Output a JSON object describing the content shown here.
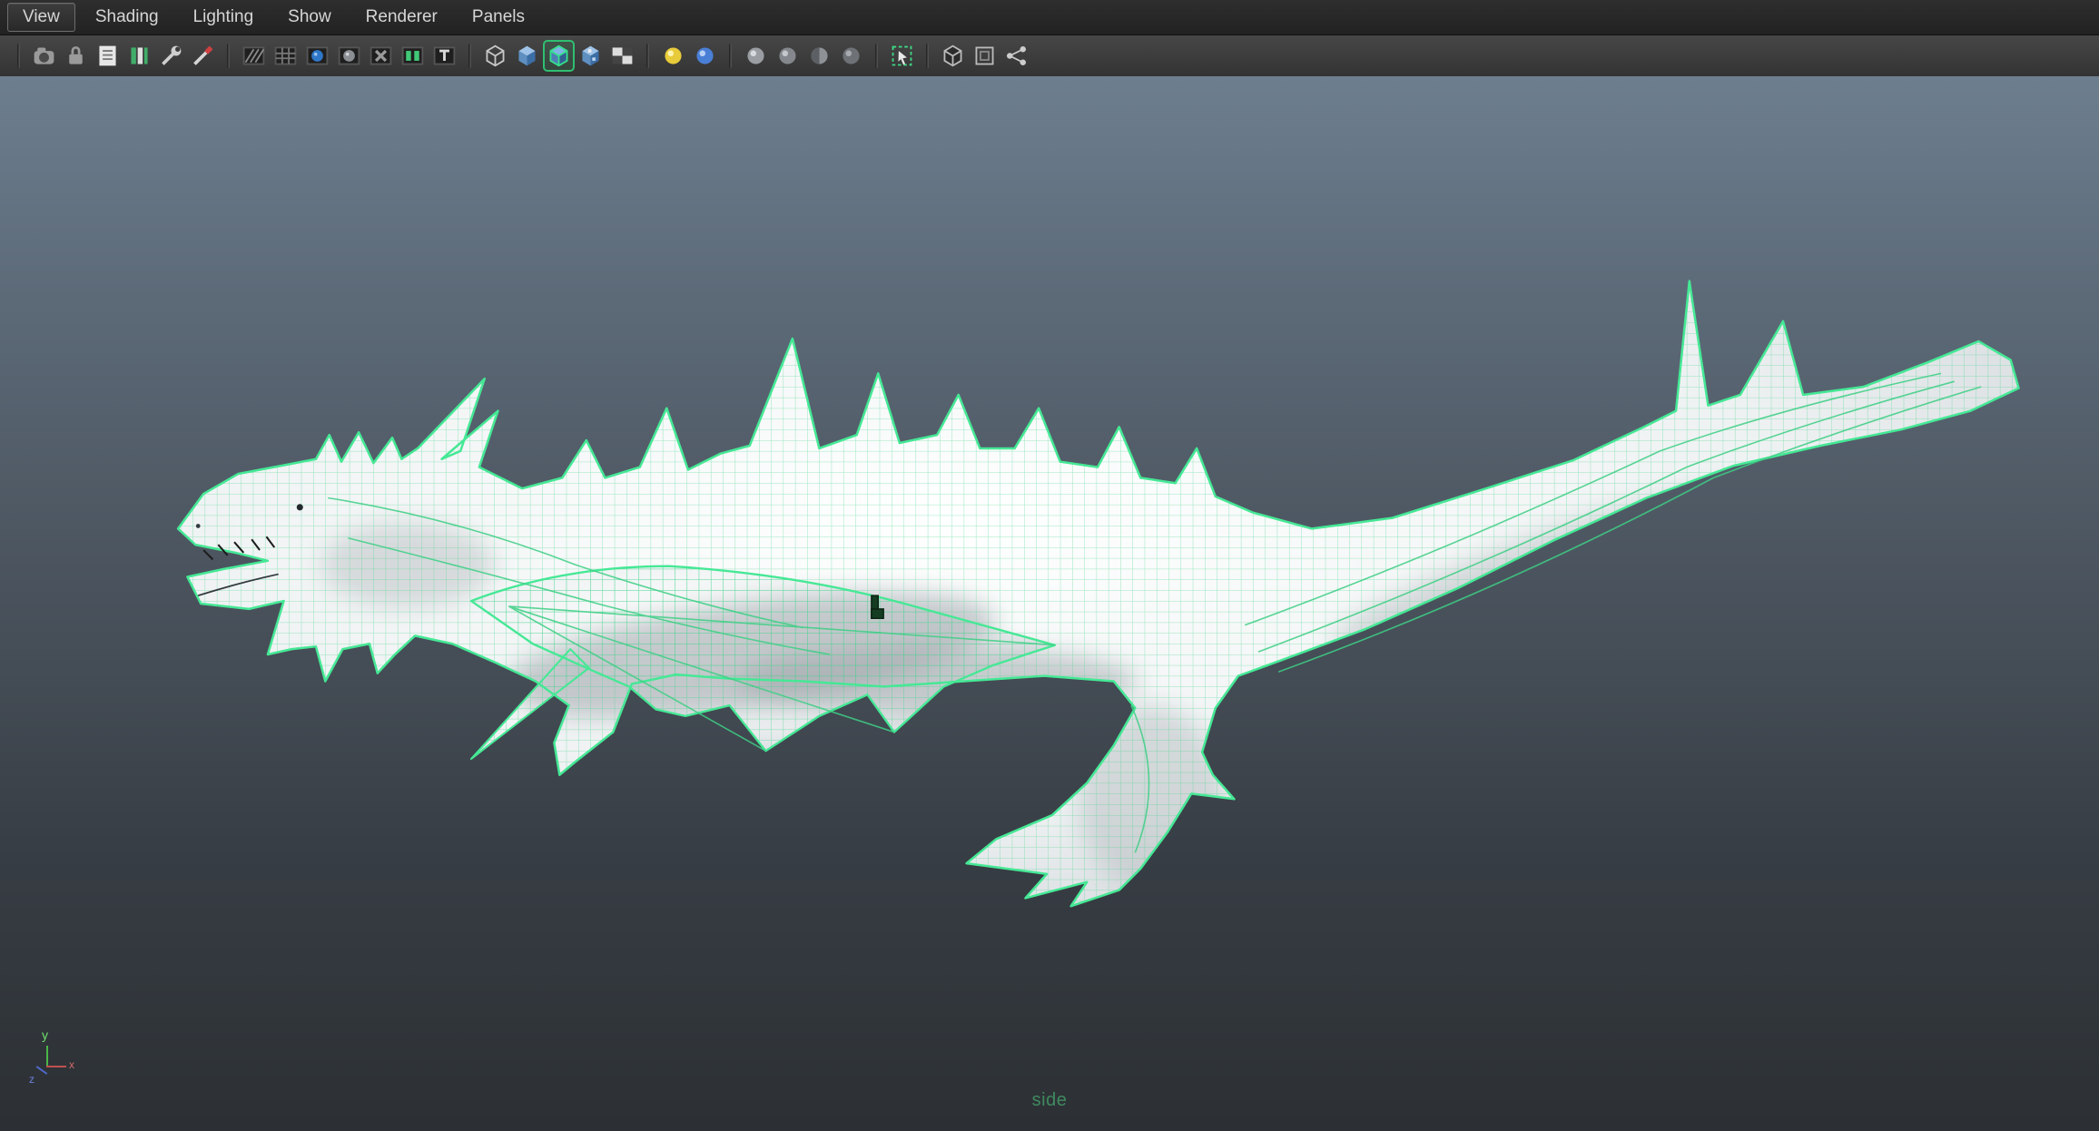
{
  "menubar": {
    "items": [
      {
        "label": "View",
        "boxed": true
      },
      {
        "label": "Shading",
        "boxed": false
      },
      {
        "label": "Lighting",
        "boxed": false
      },
      {
        "label": "Show",
        "boxed": false
      },
      {
        "label": "Renderer",
        "boxed": false
      },
      {
        "label": "Panels",
        "boxed": false
      }
    ]
  },
  "toolbar": {
    "items": [
      {
        "type": "separator"
      },
      {
        "type": "icon",
        "name": "select-camera-icon",
        "glyph": "camera",
        "active": false
      },
      {
        "type": "icon",
        "name": "lock-camera-icon",
        "glyph": "lock",
        "active": false
      },
      {
        "type": "icon",
        "name": "camera-attribute-editor-icon",
        "glyph": "doc",
        "active": false
      },
      {
        "type": "icon",
        "name": "bookmarks-icon",
        "glyph": "greenbars",
        "active": false
      },
      {
        "type": "icon",
        "name": "2d-pan-zoom-icon",
        "glyph": "wrench",
        "active": false
      },
      {
        "type": "icon",
        "name": "grease-pencil-icon",
        "glyph": "brush",
        "active": false
      },
      {
        "type": "separator"
      },
      {
        "type": "icon",
        "name": "film-gate-icon",
        "glyph": "filmstripes",
        "active": false
      },
      {
        "type": "icon",
        "name": "resolution-gate-icon",
        "glyph": "gridgate",
        "active": false
      },
      {
        "type": "icon",
        "name": "gate-mask-icon",
        "glyph": "bluecircle",
        "active": false
      },
      {
        "type": "icon",
        "name": "field-chart-icon",
        "glyph": "graycircle",
        "active": false
      },
      {
        "type": "icon",
        "name": "safe-action-icon",
        "glyph": "xicon",
        "active": false
      },
      {
        "type": "icon",
        "name": "heads-up-display-icon",
        "glyph": "greensquares",
        "active": false
      },
      {
        "type": "icon",
        "name": "safe-title-icon",
        "glyph": "tletter",
        "active": false
      },
      {
        "type": "separator"
      },
      {
        "type": "icon",
        "name": "wireframe-icon",
        "glyph": "cube-wire",
        "active": false
      },
      {
        "type": "icon",
        "name": "smooth-shade-all-icon",
        "glyph": "cube-shaded",
        "active": false
      },
      {
        "type": "icon",
        "name": "wireframe-on-shaded-icon",
        "glyph": "cube-wos",
        "active": true
      },
      {
        "type": "icon",
        "name": "textured-icon",
        "glyph": "cube-tex",
        "active": false
      },
      {
        "type": "icon",
        "name": "use-default-material-icon",
        "glyph": "checker",
        "active": false
      },
      {
        "type": "separator"
      },
      {
        "type": "icon",
        "name": "use-all-lights-icon",
        "glyph": "light-yellow",
        "active": false
      },
      {
        "type": "icon",
        "name": "shadows-icon",
        "glyph": "sphere-blue",
        "active": false
      },
      {
        "type": "separator"
      },
      {
        "type": "icon",
        "name": "xray-icon",
        "glyph": "sphere-gray",
        "active": false
      },
      {
        "type": "icon",
        "name": "xray-active-components-icon",
        "glyph": "sphere-gray2",
        "active": false
      },
      {
        "type": "icon",
        "name": "backface-culling-icon",
        "glyph": "sphere-gray3",
        "active": false
      },
      {
        "type": "icon",
        "name": "hardware-texturing-icon",
        "glyph": "sphere-gray4",
        "active": false
      },
      {
        "type": "separator"
      },
      {
        "type": "icon",
        "name": "isolate-select-icon",
        "glyph": "isolate",
        "active": false
      },
      {
        "type": "separator"
      },
      {
        "type": "icon",
        "name": "plugin-objects-icon",
        "glyph": "cube-outline",
        "active": false
      },
      {
        "type": "icon",
        "name": "plugin-shapes-icon",
        "glyph": "cube-frame",
        "active": false
      },
      {
        "type": "icon",
        "name": "viewport-renderer-icon",
        "glyph": "share",
        "active": false
      }
    ]
  },
  "viewport": {
    "view_label": "side",
    "model": "dragon-wireframe",
    "axis": {
      "x": "x",
      "y": "y",
      "z": "z"
    }
  },
  "colors": {
    "wireframe_green": "#45e895",
    "active_icon_highlight": "#2fbf71",
    "viewport_top": "#6d7e8f",
    "viewport_bottom": "#2c3034"
  }
}
